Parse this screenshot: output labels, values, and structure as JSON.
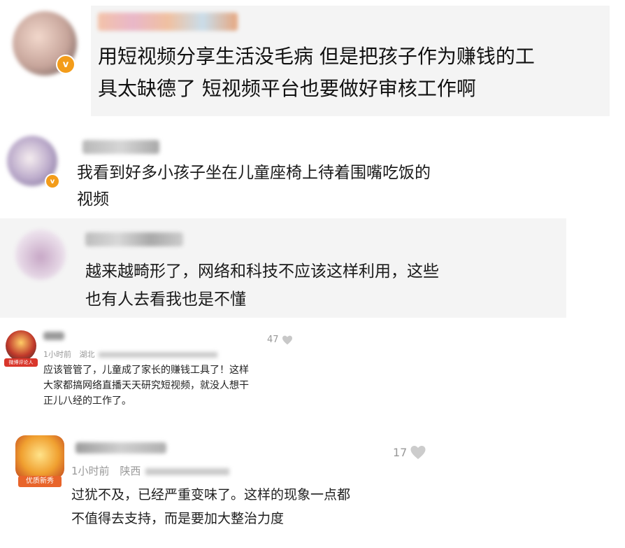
{
  "comments": [
    {
      "text": "用短视频分享生活没毛病 但是把孩子作为赚钱的工\n具太缺德了 短视频平台也要做好审核工作啊"
    },
    {
      "text": "我看到好多小孩子坐在儿童座椅上待着围嘴吃饭的\n视频"
    },
    {
      "text": "越来越畸形了，网络和科技不应该这样利用，这些\n也有人去看我也是不懂"
    },
    {
      "time": "1小时前",
      "location": "湖北",
      "likes": "47",
      "badge": "微博评论人",
      "text": "应该管管了，儿童成了家长的赚钱工具了！这样\n大家都搞网络直播天天研究短视频，就没人想干\n正儿八经的工作了。"
    },
    {
      "time": "1小时前",
      "location": "陕西",
      "likes": "17",
      "badge": "优质新秀",
      "text": "过犹不及，已经严重变味了。这样的现象一点都\n不值得去支持，而是要加大整治力度"
    }
  ],
  "icons": {
    "verify": "verified-v-icon",
    "like": "heart-icon"
  },
  "colors": {
    "panel_bg": "#f4f4f4",
    "verify_orange": "#f39c1a",
    "meta_gray": "#999999"
  }
}
